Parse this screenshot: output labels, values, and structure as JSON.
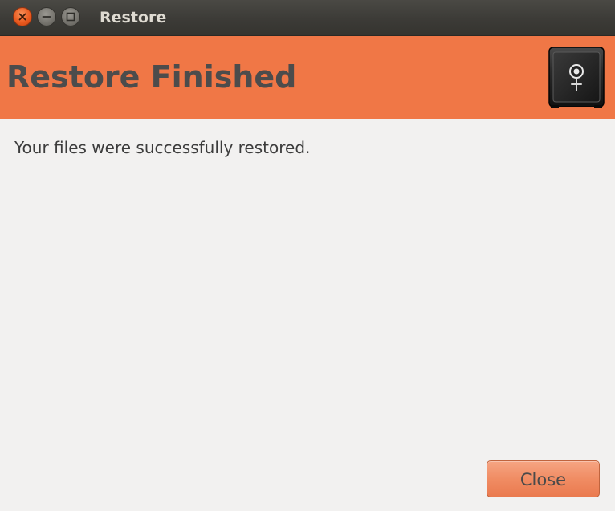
{
  "window": {
    "title": "Restore",
    "controls": {
      "close": "close-icon",
      "minimize": "minimize-icon",
      "maximize": "maximize-icon"
    }
  },
  "header": {
    "title": "Restore Finished",
    "icon": "safe-icon",
    "background_color": "#f07746"
  },
  "body": {
    "message": "Your files were successfully restored."
  },
  "footer": {
    "close_label": "Close"
  }
}
